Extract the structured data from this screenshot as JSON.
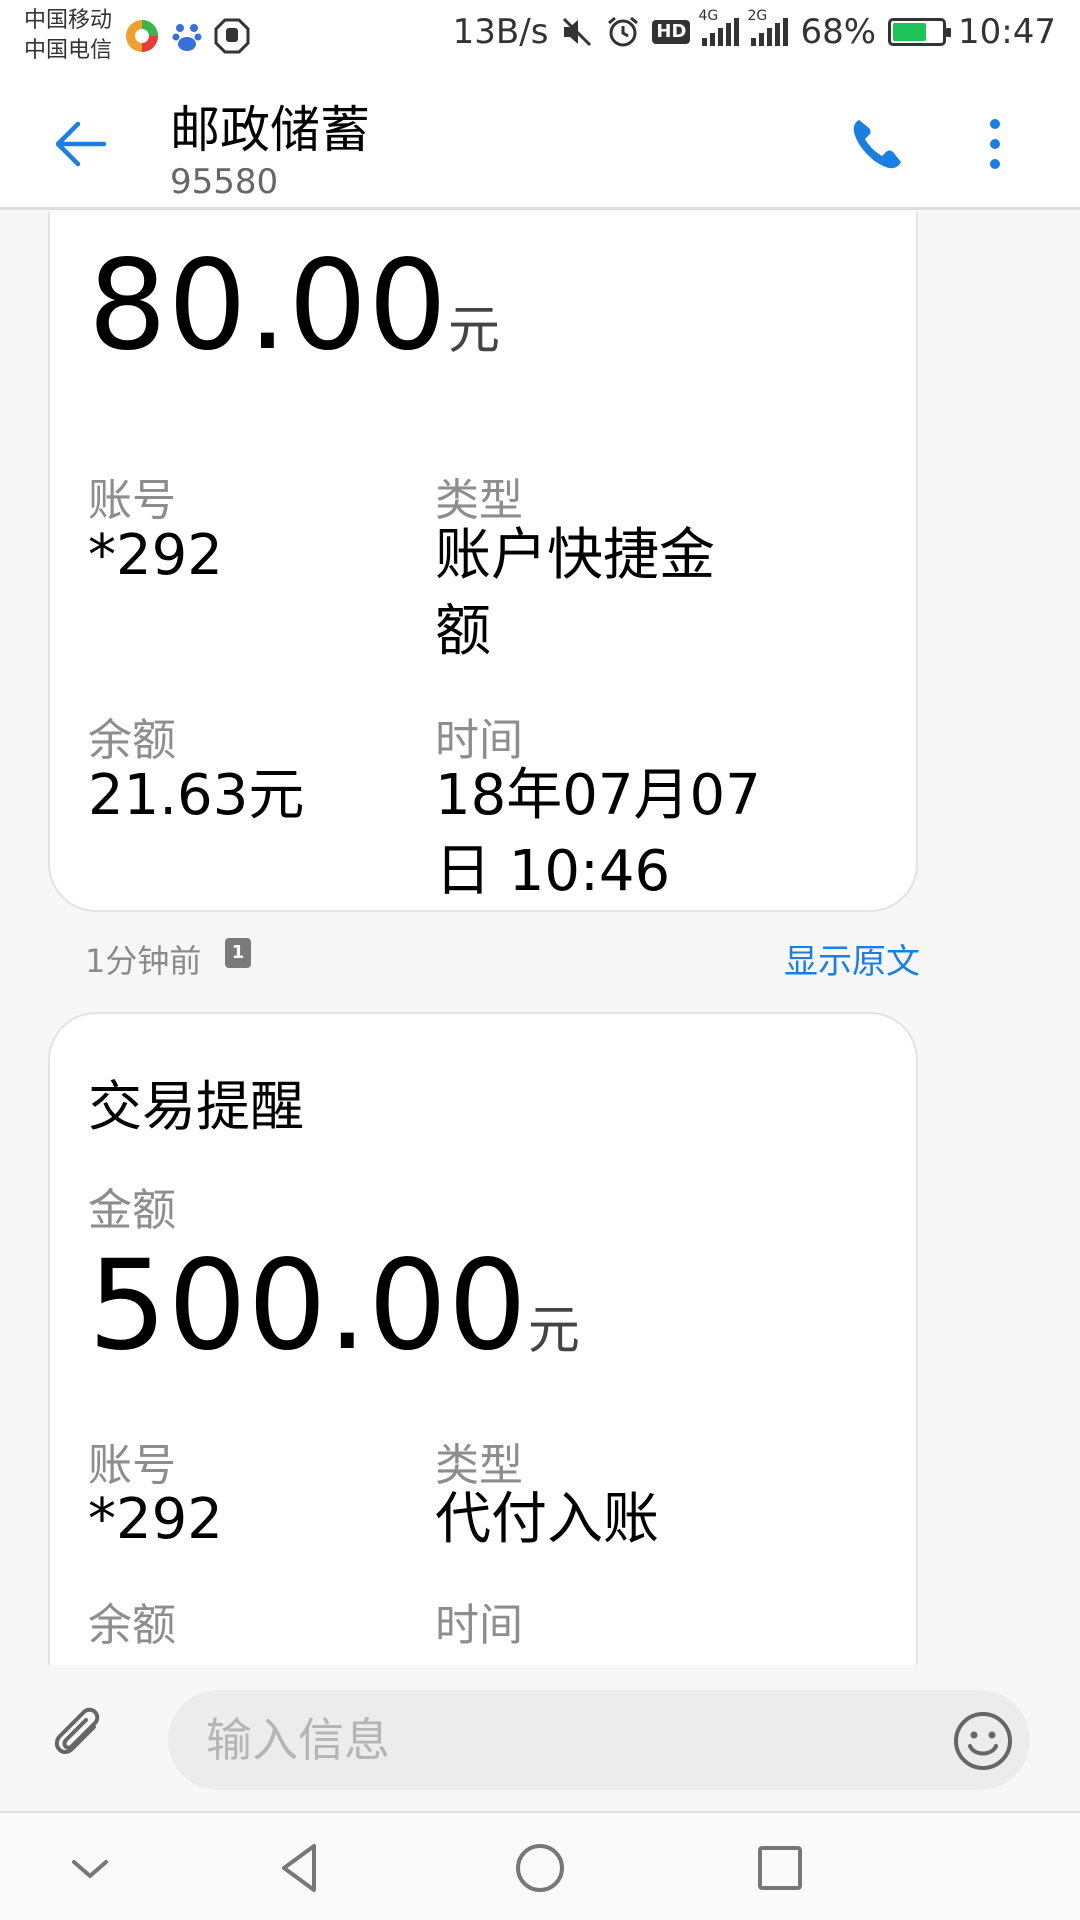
{
  "status_bar": {
    "carrier1": "中国移动",
    "carrier2": "中国电信",
    "net_speed": "13B/s",
    "hd": "HD",
    "sig1_tag": "4G",
    "sig2_tag": "2G",
    "battery": "68%",
    "battery_level": 0.68,
    "time": "10:47",
    "icons": [
      "app-icon",
      "baidu-icon",
      "hand-icon",
      "mute-icon",
      "alarm-icon",
      "signal-icon",
      "battery-icon"
    ]
  },
  "header": {
    "title": "邮政储蓄",
    "number": "95580",
    "accent": "#1a7fe0"
  },
  "card1": {
    "amount": "80.00",
    "unit": "元",
    "account_label": "账号",
    "account": "*292",
    "type_label": "类型",
    "type_line1": "账户快捷金",
    "type_line2": "额",
    "balance_label": "余额",
    "balance": "21.63元",
    "time_label": "时间",
    "time_line1": "18年07月07",
    "time_line2": "日 10:46",
    "meta_time": "1分钟前",
    "sim": "1",
    "show_original": "显示原文"
  },
  "card2": {
    "title": "交易提醒",
    "amount_label": "金额",
    "amount": "500.00",
    "unit": "元",
    "account_label": "账号",
    "account": "*292",
    "type_label": "类型",
    "type": "代付入账",
    "balance_label": "余额",
    "time_label": "时间"
  },
  "input": {
    "placeholder": "输入信息"
  },
  "navbar": {
    "icons": [
      "collapse-icon",
      "back-icon",
      "home-icon",
      "recents-icon"
    ]
  }
}
